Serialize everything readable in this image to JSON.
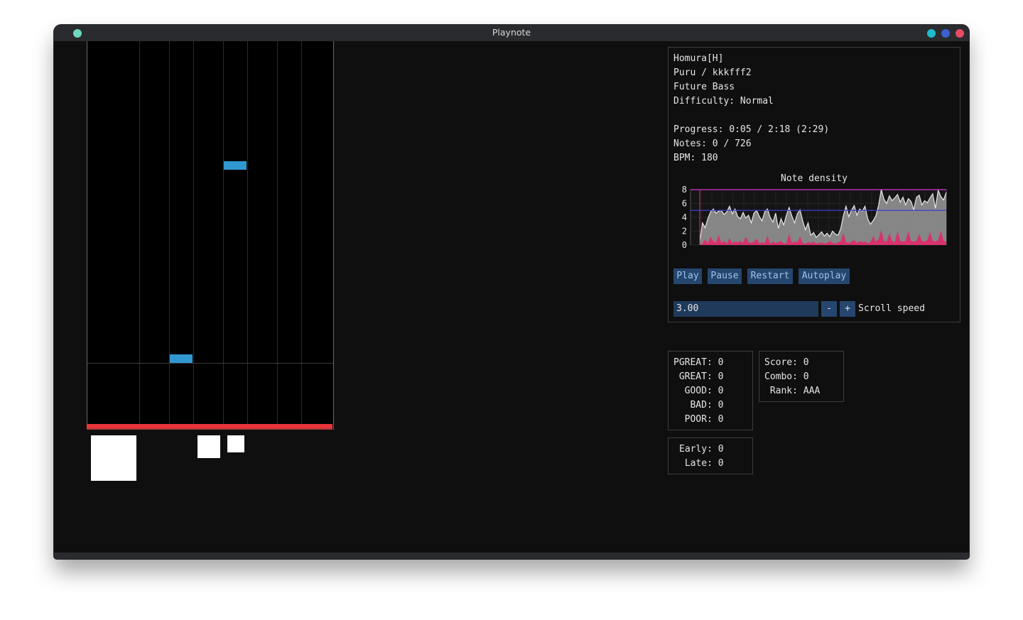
{
  "window": {
    "title": "Playnote",
    "colors": {
      "left_dot": "#6fd6c0",
      "dot_teal": "#1fbccb",
      "dot_blue": "#3d5fcf",
      "dot_red": "#e94b64"
    }
  },
  "playfield": {
    "lane_count": 8,
    "note_color": "#3097d1",
    "judge_bar_color": "#e8343a"
  },
  "song_info": {
    "title": "Homura[H]",
    "artist": "Puru / kkkfff2",
    "genre": "Future Bass",
    "difficulty": "Difficulty: Normal",
    "progress": "Progress: 0:05 / 2:18 (2:29)",
    "notes": "Notes: 0 / 726",
    "bpm": "BPM: 180"
  },
  "chart_data": {
    "type": "area",
    "title": "Note density",
    "xlabel": "",
    "ylabel": "",
    "ylim": [
      0,
      8
    ],
    "yticks": [
      "8",
      "6",
      "4",
      "2",
      "0"
    ],
    "reference_lines": [
      {
        "color": "#d633d6",
        "y": 8
      },
      {
        "color": "#3b3bd6",
        "y": 5
      }
    ],
    "series": [
      {
        "color": "#9a9a9a",
        "values": [
          0.5,
          3.2,
          2.5,
          3.8,
          4.8,
          5.2,
          4.6,
          4.9,
          5.0,
          4.4,
          4.8,
          5.6,
          4.5,
          5.2,
          4.1,
          3.8,
          4.7,
          3.9,
          4.3,
          3.2,
          4.6,
          5.0,
          4.1,
          3.5,
          4.8,
          5.2,
          4.0,
          3.3,
          4.6,
          2.4,
          3.8,
          2.9,
          4.3,
          5.4,
          4.2,
          3.2,
          4.5,
          5.1,
          3.5,
          2.2,
          3.2,
          1.4,
          1.8,
          1.1,
          1.5,
          1.9,
          1.3,
          1.7,
          1.2,
          2.0,
          1.6,
          1.4,
          2.3,
          4.2,
          5.6,
          4.1,
          5.0,
          5.7,
          4.3,
          5.2,
          4.9,
          5.6,
          3.8,
          3.0,
          3.5,
          4.2,
          5.7,
          8.1,
          6.6,
          6.0,
          7.1,
          6.4,
          6.8,
          7.3,
          6.2,
          6.9,
          5.8,
          6.7,
          6.3,
          5.1,
          6.9,
          7.2,
          5.8,
          6.4,
          6.1,
          6.8,
          7.4,
          5.3,
          7.9,
          7.0,
          6.5,
          7.6
        ]
      },
      {
        "color": "#d8326e",
        "values": [
          0.0,
          0.2,
          0.8,
          0.3,
          1.2,
          0.5,
          0.4,
          1.4,
          0.3,
          0.6,
          0.2,
          1.0,
          0.3,
          0.5,
          0.4,
          0.6,
          0.3,
          1.2,
          0.4,
          0.3,
          0.5,
          0.9,
          0.2,
          0.4,
          0.3,
          1.3,
          0.2,
          0.5,
          0.3,
          0.4,
          0.6,
          0.2,
          0.3,
          1.6,
          0.3,
          0.5,
          0.4,
          1.2,
          0.3,
          0.2,
          0.4,
          0.3,
          0.5,
          0.2,
          0.3,
          0.4,
          0.2,
          0.3,
          0.6,
          0.3,
          0.2,
          0.4,
          0.5,
          1.8,
          0.4,
          0.3,
          0.5,
          0.7,
          0.3,
          0.6,
          0.4,
          0.5,
          0.3,
          0.4,
          1.3,
          0.5,
          0.8,
          2.2,
          0.6,
          0.5,
          1.7,
          0.6,
          0.4,
          2.0,
          0.6,
          0.5,
          0.6,
          2.0,
          0.6,
          0.5,
          0.6,
          1.6,
          0.6,
          0.5,
          0.7,
          1.9,
          0.6,
          0.5,
          0.7,
          2.1,
          0.6,
          0.5
        ]
      }
    ]
  },
  "controls": {
    "play": "Play",
    "pause": "Pause",
    "restart": "Restart",
    "autoplay": "Autoplay",
    "scroll_value": "3.00",
    "minus": "-",
    "plus": "+",
    "scroll_label": "Scroll speed"
  },
  "judgements": {
    "pgreat": "PGREAT: 0",
    "great": " GREAT: 0",
    "good": "  GOOD: 0",
    "bad": "   BAD: 0",
    "poor": "  POOR: 0"
  },
  "score": {
    "score": "Score: 0",
    "combo": "Combo: 0",
    "rank": " Rank: AAA"
  },
  "timing": {
    "early": "Early: 0",
    "late": " Late: 0"
  }
}
